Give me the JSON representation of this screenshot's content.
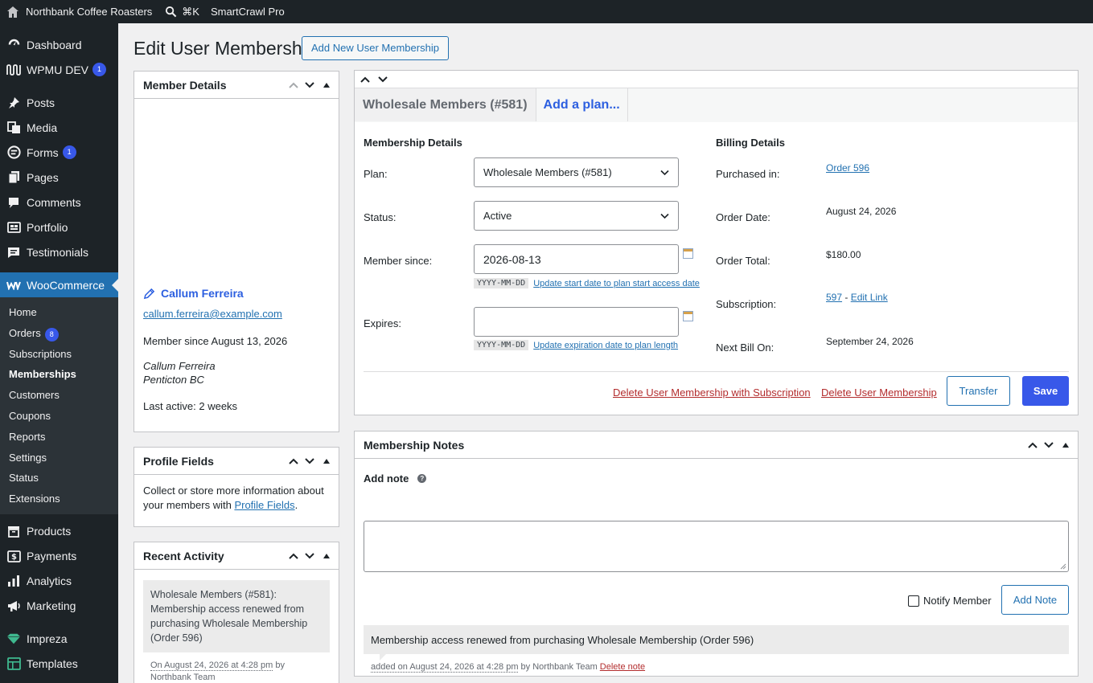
{
  "adminbar": {
    "site_name": "Northbank Coffee Roasters",
    "search_shortcut": "⌘K",
    "plugin": "SmartCrawl Pro"
  },
  "sidebar": {
    "top_items": [
      {
        "label": "Dashboard",
        "icon": "dashboard-icon"
      },
      {
        "label": "WPMU DEV",
        "icon": "wpmudev-icon",
        "badge": "1"
      }
    ],
    "items": [
      {
        "label": "Posts",
        "icon": "pin-icon"
      },
      {
        "label": "Media",
        "icon": "media-icon"
      },
      {
        "label": "Forms",
        "icon": "forms-icon",
        "badge": "1"
      },
      {
        "label": "Pages",
        "icon": "pages-icon"
      },
      {
        "label": "Comments",
        "icon": "comments-icon"
      },
      {
        "label": "Portfolio",
        "icon": "portfolio-icon"
      },
      {
        "label": "Testimonials",
        "icon": "testimonials-icon"
      }
    ],
    "current": {
      "label": "WooCommerce",
      "icon": "woocommerce-icon"
    },
    "submenu": [
      {
        "label": "Home"
      },
      {
        "label": "Orders",
        "badge": "8"
      },
      {
        "label": "Subscriptions"
      },
      {
        "label": "Memberships"
      },
      {
        "label": "Customers"
      },
      {
        "label": "Coupons"
      },
      {
        "label": "Reports"
      },
      {
        "label": "Settings"
      },
      {
        "label": "Status"
      },
      {
        "label": "Extensions"
      }
    ],
    "after_items": [
      {
        "label": "Products",
        "icon": "products-icon"
      },
      {
        "label": "Payments",
        "icon": "payments-icon"
      },
      {
        "label": "Analytics",
        "icon": "analytics-icon"
      },
      {
        "label": "Marketing",
        "icon": "marketing-icon"
      }
    ],
    "bottom_items": [
      {
        "label": "Impreza",
        "icon": "impreza-icon"
      },
      {
        "label": "Templates",
        "icon": "templates-icon"
      }
    ]
  },
  "page": {
    "title": "Edit User Membership",
    "add_new": "Add New User Membership"
  },
  "member_details": {
    "title": "Member Details",
    "name": "Callum Ferreira",
    "email": "callum.ferreira@example.com",
    "member_since": "Member since August 13, 2026",
    "address_name": "Callum Ferreira",
    "address_city": "Penticton BC",
    "last_active": "Last active: 2 weeks"
  },
  "profile_fields": {
    "title": "Profile Fields",
    "text": "Collect or store more information about your members with",
    "link": "Profile Fields",
    "end": "."
  },
  "recent_activity": {
    "title": "Recent Activity",
    "note": "Wholesale Members (#581): Membership access renewed from purchasing Wholesale Membership (Order 596)",
    "meta_date": "On August 24, 2026 at 4:28 pm",
    "meta_by": "by",
    "meta_author": "Northbank Team"
  },
  "membership": {
    "tab_active": "Wholesale Members (#581)",
    "tab_add": "Add a plan...",
    "details_heading": "Membership Details",
    "billing_heading": "Billing Details",
    "plan_label": "Plan:",
    "plan_value": "Wholesale Members (#581)",
    "status_label": "Status:",
    "status_value": "Active",
    "since_label": "Member since:",
    "since_value": "2026-08-13",
    "date_format": "YYYY-MM-DD",
    "since_link": "Update start date to plan start access date",
    "expires_label": "Expires:",
    "expires_value": "",
    "expires_link": "Update expiration date to plan length",
    "purchased_label": "Purchased in:",
    "purchased_value": "Order 596",
    "order_date_label": "Order Date:",
    "order_date_value": "August 24, 2026",
    "order_total_label": "Order Total:",
    "order_total_value": "$180.00",
    "subscription_label": "Subscription:",
    "subscription_id": "597",
    "subscription_sep": " - ",
    "subscription_edit": "Edit Link",
    "next_bill_label": "Next Bill On:",
    "next_bill_value": "September 24, 2026",
    "delete_with_sub": "Delete User Membership with Subscription",
    "delete": "Delete User Membership",
    "transfer": "Transfer",
    "save": "Save"
  },
  "notes": {
    "title": "Membership Notes",
    "add_note_label": "Add note",
    "notify_label": "Notify Member",
    "add_note_button": "Add Note",
    "note_text": "Membership access renewed from purchasing Wholesale Membership (Order 596)",
    "note_meta_added": "added on August 24, 2026 at 4:28 pm",
    "note_meta_by": "by Northbank Team",
    "delete_note": "Delete note"
  }
}
